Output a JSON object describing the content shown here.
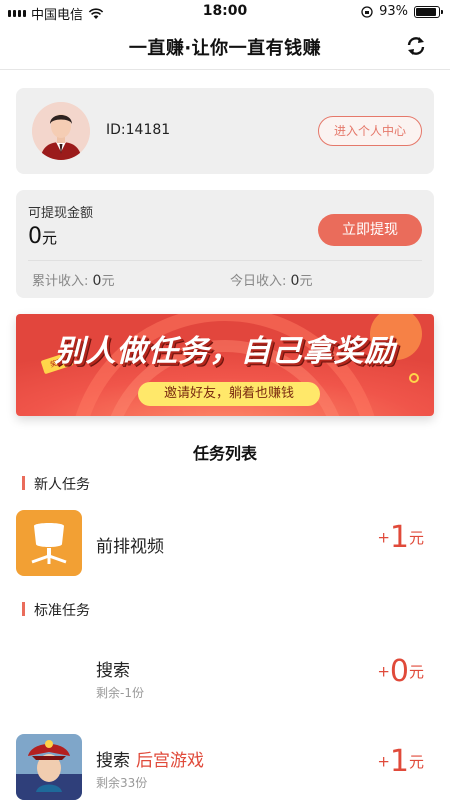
{
  "status_bar": {
    "carrier": "中国电信",
    "time": "18:00",
    "battery": "93%",
    "battery_level": 0.93
  },
  "nav": {
    "title": "一直赚·让你一直有钱赚",
    "refresh_icon": "refresh-icon"
  },
  "profile": {
    "id_text": "ID:14181",
    "center_button": "进入个人中心"
  },
  "withdraw": {
    "label": "可提现金额",
    "amount": "0",
    "unit": "元",
    "button": "立即提现",
    "total_label": "累计收入:",
    "total_value": "0",
    "total_unit": "元",
    "today_label": "今日收入:",
    "today_value": "0",
    "today_unit": "元"
  },
  "banner": {
    "headline": "别人做任务，自己拿奖励",
    "sub": "邀请好友，躺着也赚钱",
    "tag": "奖励"
  },
  "tasks_section": {
    "title": "任务列表",
    "category_new": "新人任务",
    "category_standard": "标准任务",
    "items": [
      {
        "name": "前排视频",
        "highlight": "",
        "sub": "",
        "plus": "+",
        "reward": "1",
        "unit": "元"
      },
      {
        "name": "搜索",
        "highlight": "",
        "sub": "剩余-1份",
        "plus": "+",
        "reward": "0",
        "unit": "元"
      },
      {
        "name": "搜索",
        "highlight": "后宫游戏",
        "sub": "剩余33份",
        "plus": "+",
        "reward": "1",
        "unit": "元"
      }
    ]
  },
  "colors": {
    "accent": "#ea6c5b",
    "reward": "#e04a3a",
    "card_bg": "#efefef",
    "app_icon_orange": "#f2a034"
  }
}
